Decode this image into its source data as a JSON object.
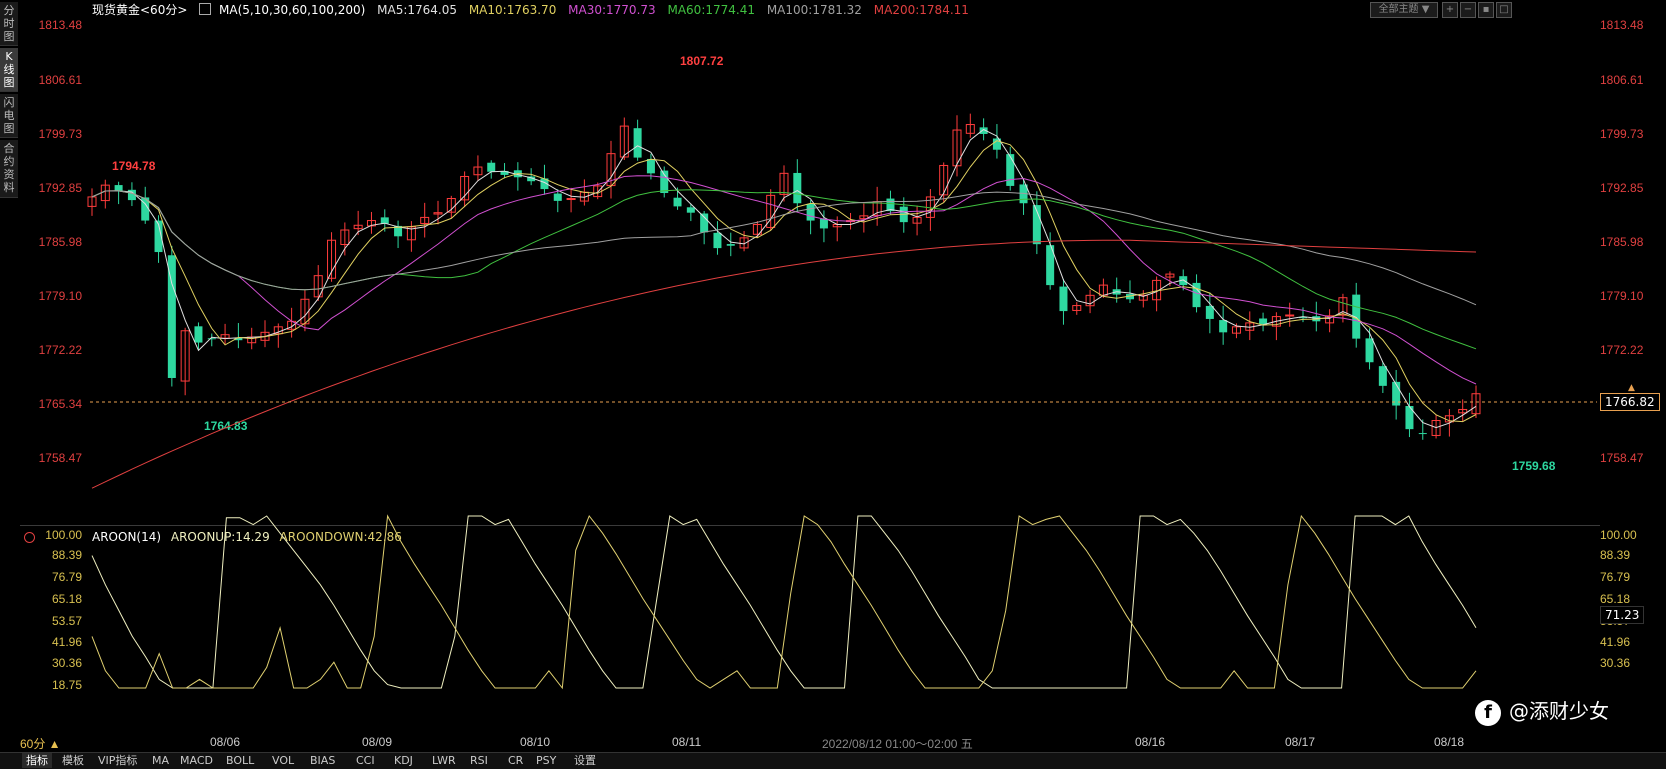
{
  "side_tabs": [
    {
      "label": "分时图",
      "active": false
    },
    {
      "label": "K线图",
      "active": true
    },
    {
      "label": "闪电图",
      "active": false
    },
    {
      "label": "合约资料",
      "active": false
    }
  ],
  "legend": {
    "instrument": "现货黄金<60分>",
    "ma_title": "MA(5,10,30,60,100,200)",
    "items": [
      {
        "text": "MA5:1764.05",
        "color": "#e0e0e0"
      },
      {
        "text": "MA10:1763.70",
        "color": "#e0d060"
      },
      {
        "text": "MA30:1770.73",
        "color": "#d050d0"
      },
      {
        "text": "MA60:1774.41",
        "color": "#40c040"
      },
      {
        "text": "MA100:1781.32",
        "color": "#a0a0a0"
      },
      {
        "text": "MA200:1784.11",
        "color": "#e04040"
      }
    ]
  },
  "theme_select": "全部主题",
  "price_axis": [
    "1813.48",
    "1806.61",
    "1799.73",
    "1792.85",
    "1785.98",
    "1779.10",
    "1772.22",
    "1765.34",
    "1758.47"
  ],
  "current_price": "1766.82",
  "annotations": {
    "high_left": "1794.78",
    "peak": "1807.72",
    "low_left": "1764.83",
    "low_right": "1759.68"
  },
  "indicator": {
    "name": "AROON(14)",
    "up": "AROONUP:14.29",
    "down": "AROONDOWN:42.86",
    "axis": [
      "100.00",
      "88.39",
      "76.79",
      "65.18",
      "53.57",
      "41.96",
      "30.36",
      "18.75"
    ],
    "current": "71.23"
  },
  "x_labels": [
    "08/06",
    "08/09",
    "08/10",
    "08/11",
    "2022/08/12 01:00～02:00 五",
    "08/16",
    "08/17",
    "08/18"
  ],
  "period_button": "60分 ▲",
  "bottom_tabs": [
    "指标",
    "模板",
    "VIP指标",
    "MA",
    "MACD",
    "BOLL",
    "VOL",
    "BIAS",
    "CCI",
    "KDJ",
    "LWR",
    "RSI",
    "CR",
    "PSY",
    "设置"
  ],
  "watermark": "@添财少女",
  "colors": {
    "up": "#ff3c3c",
    "down": "#2ed8a0",
    "ma5": "#e0e0e0",
    "ma10": "#e0d060",
    "ma30": "#d050d0",
    "ma60": "#40c040",
    "ma100": "#a0a0a0",
    "ma200": "#e04040",
    "aroon_up": "#f0f0c0",
    "aroon_down": "#e0d070"
  },
  "chart_data": [
    {
      "type": "candlestick",
      "title": "现货黄金 60分",
      "ylim": [
        1755,
        1814
      ],
      "categories": [
        "08/06",
        "08/09",
        "08/10",
        "08/11",
        "08/12",
        "08/16",
        "08/17",
        "08/18"
      ],
      "closes": [
        1791.0,
        1792.5,
        1791.8,
        1790.6,
        1788.0,
        1784.0,
        1768.0,
        1774.0,
        1772.5,
        1773.0,
        1773.5,
        1772.8,
        1773.2,
        1773.8,
        1774.5,
        1775.2,
        1778.0,
        1781.0,
        1785.5,
        1786.8,
        1787.4,
        1788.0,
        1787.6,
        1786.0,
        1787.2,
        1788.4,
        1789.0,
        1790.8,
        1793.6,
        1794.8,
        1794.2,
        1793.8,
        1793.5,
        1793.0,
        1792.0,
        1790.5,
        1790.8,
        1791.6,
        1792.4,
        1796.5,
        1800.0,
        1796.0,
        1794.0,
        1791.5,
        1789.8,
        1789.0,
        1786.5,
        1784.5,
        1784.8,
        1785.8,
        1787.5,
        1791.2,
        1794.0,
        1790.2,
        1788.0,
        1787.0,
        1787.5,
        1788.0,
        1788.6,
        1790.4,
        1789.2,
        1787.8,
        1788.4,
        1791.0,
        1795.0,
        1799.5,
        1800.2,
        1799.0,
        1797.0,
        1792.4,
        1790.2,
        1785.0,
        1779.8,
        1776.5,
        1777.2,
        1778.5,
        1779.8,
        1778.6,
        1778.0,
        1778.5,
        1780.4,
        1781.2,
        1779.8,
        1777.0,
        1775.5,
        1773.8,
        1774.5,
        1775.0,
        1774.8,
        1775.8,
        1776.0,
        1775.6,
        1775.2,
        1775.9,
        1778.2,
        1773.0,
        1770.0,
        1767.0,
        1764.5,
        1761.5,
        1761.0,
        1762.6,
        1763.2,
        1764.0,
        1766.0
      ],
      "aroon_up": [
        77,
        60,
        45,
        30,
        18,
        5,
        0,
        0,
        0,
        0,
        99,
        99,
        95,
        100,
        90,
        80,
        70,
        60,
        48,
        35,
        22,
        10,
        2,
        0,
        0,
        0,
        0,
        30,
        100,
        100,
        95,
        98,
        85,
        72,
        60,
        48,
        35,
        22,
        10,
        0,
        0,
        0,
        50,
        100,
        95,
        98,
        85,
        72,
        60,
        48,
        35,
        22,
        10,
        0,
        0,
        0,
        0,
        100,
        100,
        90,
        80,
        68,
        55,
        42,
        30,
        18,
        5,
        0,
        0,
        0,
        0,
        0,
        0,
        0,
        0,
        0,
        0,
        0,
        100,
        100,
        95,
        98,
        90,
        80,
        68,
        55,
        42,
        30,
        18,
        5,
        0,
        0,
        0,
        0,
        100,
        100,
        100,
        95,
        100,
        85,
        72,
        60,
        48,
        35
      ],
      "aroon_down": [
        30,
        10,
        0,
        0,
        0,
        20,
        0,
        0,
        5,
        0,
        0,
        0,
        0,
        12,
        35,
        0,
        0,
        5,
        15,
        0,
        0,
        30,
        100,
        85,
        72,
        60,
        48,
        35,
        22,
        10,
        0,
        0,
        0,
        0,
        10,
        0,
        80,
        100,
        90,
        78,
        65,
        52,
        40,
        28,
        16,
        5,
        0,
        5,
        10,
        0,
        0,
        0,
        55,
        100,
        95,
        85,
        72,
        60,
        48,
        35,
        22,
        10,
        0,
        0,
        0,
        0,
        0,
        10,
        45,
        100,
        95,
        98,
        100,
        90,
        80,
        68,
        55,
        42,
        30,
        18,
        5,
        0,
        0,
        0,
        0,
        10,
        0,
        0,
        0,
        60,
        100,
        90,
        78,
        65,
        52,
        40,
        28,
        16,
        5,
        0,
        0,
        0,
        0,
        10
      ]
    }
  ]
}
